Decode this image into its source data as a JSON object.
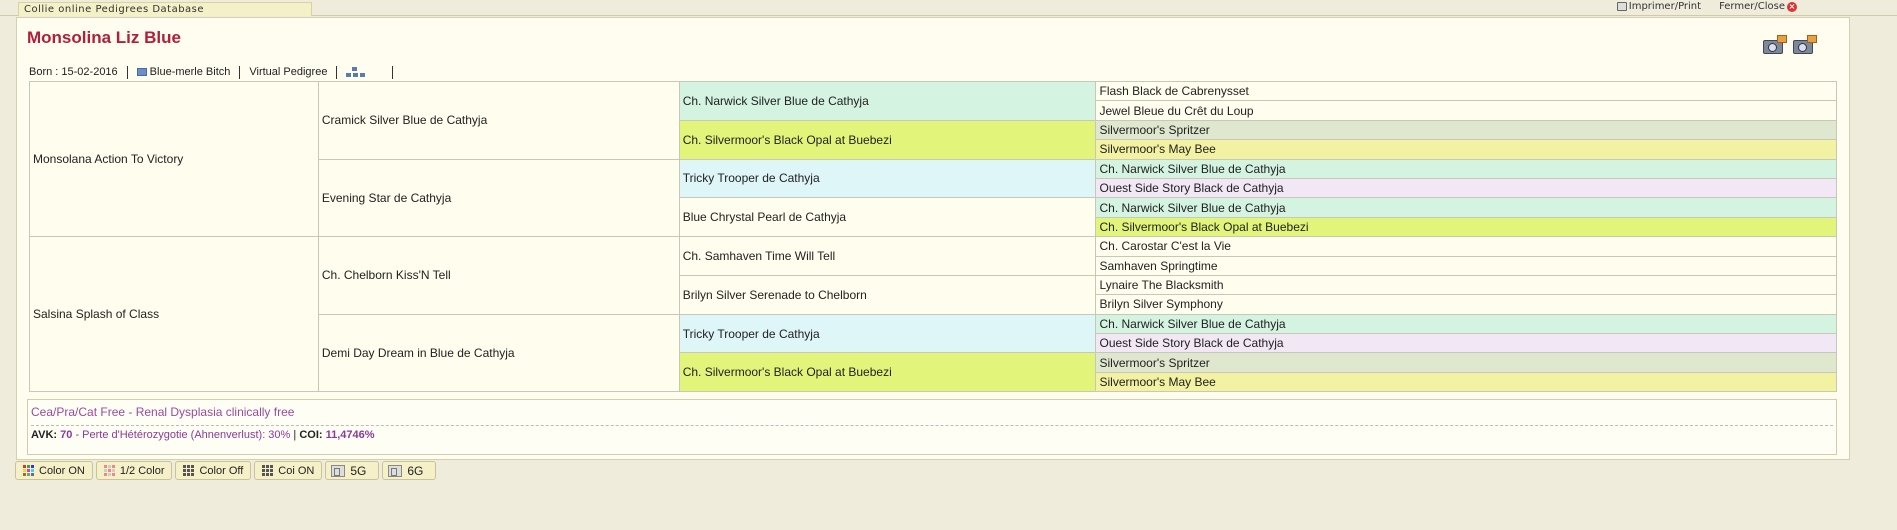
{
  "site_title": "Collie online Pedigrees Database",
  "top_links": {
    "print": "Imprimer/Print",
    "close": "Fermer/Close"
  },
  "dog": {
    "name": "Monsolina Liz Blue",
    "born": "Born : 15-02-2016",
    "color_sex": "Blue-merle Bitch",
    "virtual_pedigree": "Virtual Pedigree",
    "swatch_color": "#6d8fc7"
  },
  "colors": {
    "default": "#fefdee",
    "mint": "#d4f3e1",
    "lime": "#e2f57a",
    "sage": "#dfe8cf",
    "yellow": "#f2f2a2",
    "cyan": "#def6f8",
    "lavender": "#f1e7f5"
  },
  "pedigree": {
    "g1": [
      "Monsolana Action To Victory",
      "Salsina Splash of Class"
    ],
    "g2": [
      "Cramick Silver Blue de Cathyja",
      "Evening Star de Cathyja",
      "Ch. Chelborn Kiss'N Tell",
      "Demi Day Dream in Blue de Cathyja"
    ],
    "g3": [
      "Ch. Narwick Silver Blue de Cathyja",
      "Ch. Silvermoor's Black Opal at Buebezi",
      "Tricky Trooper de Cathyja",
      "Blue Chrystal Pearl de Cathyja",
      "Ch. Samhaven Time Will Tell",
      "Brilyn Silver Serenade to Chelborn",
      "Tricky Trooper de Cathyja",
      "Ch. Silvermoor's Black Opal at Buebezi"
    ],
    "g4": [
      "Flash Black de Cabrenysset",
      "Jewel Bleue du Crêt du Loup",
      "Silvermoor's Spritzer",
      "Silvermoor's May Bee",
      "Ch. Narwick Silver Blue de Cathyja",
      "Ouest Side Story Black de Cathyja",
      "Ch. Narwick Silver Blue de Cathyja",
      "Ch. Silvermoor's Black Opal at Buebezi",
      "Ch. Carostar C'est la Vie",
      "Samhaven Springtime",
      "Lynaire The Blacksmith",
      "Brilyn Silver Symphony",
      "Ch. Narwick Silver Blue de Cathyja",
      "Ouest Side Story Black de Cathyja",
      "Silvermoor's Spritzer",
      "Silvermoor's May Bee"
    ]
  },
  "health": {
    "text": "Cea/Pra/Cat Free - Renal Dysplasia clinically free",
    "avk_label": "AVK:",
    "avk_value": "70",
    "avk_desc": "- Perte d'Hétérozygotie (Ahnenverlust): 30%",
    "sep": "|",
    "coi_label": "COI:",
    "coi_value": "11,4746%"
  },
  "buttons": {
    "color_on": "Color ON",
    "half_color": "1/2 Color",
    "color_off": "Color Off",
    "coi_on": "Coi ON",
    "g5": "5G",
    "g6": "6G"
  }
}
